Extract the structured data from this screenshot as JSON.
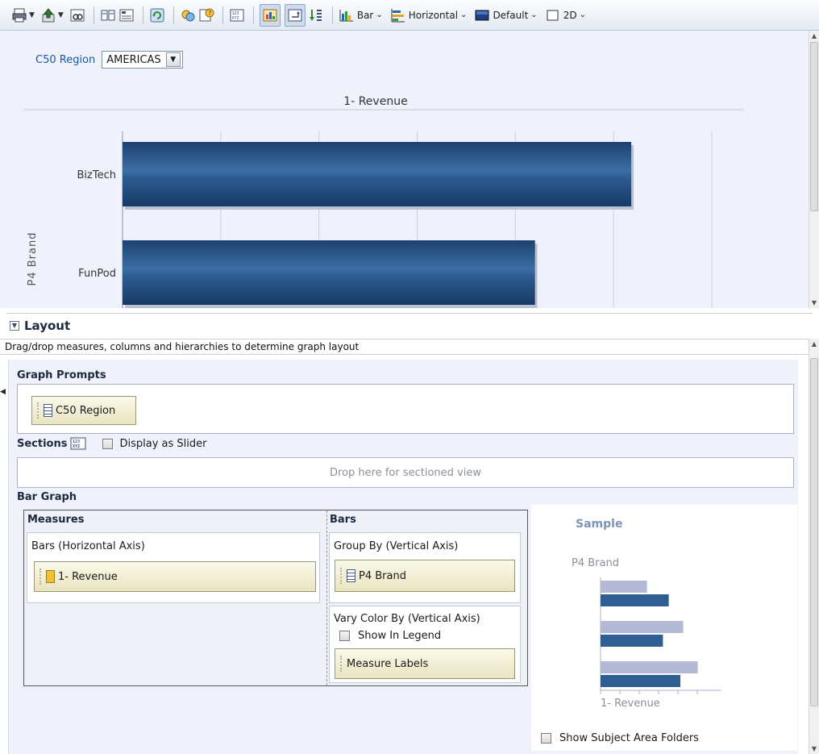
{
  "toolbar": {
    "graph_type_label": "Bar",
    "orientation_label": "Horizontal",
    "style_label": "Default",
    "dimension_label": "2D",
    "icons": [
      "print-icon",
      "export-icon",
      "preview-icon",
      "edit-icon",
      "properties-icon",
      "refresh-icon",
      "add-view-icon",
      "help-icon",
      "section-slider-icon",
      "show-chart-icon",
      "show-pivot-icon",
      "sort-icon",
      "bar-chart-icon",
      "horizontal-bar-icon",
      "style-icon",
      "2d-icon"
    ]
  },
  "prompt": {
    "label": "C50 Region",
    "value": "AMERICAS"
  },
  "chart_data": {
    "type": "bar",
    "orientation": "horizontal",
    "title": "1- Revenue",
    "ylabel": "P4 Brand",
    "categories": [
      "BizTech",
      "FunPod"
    ],
    "values": [
      5.18,
      4.2
    ],
    "xlim": [
      0,
      6
    ],
    "grid": true,
    "bar_color": "#1f4a7c"
  },
  "layout": {
    "title": "Layout",
    "hint": "Drag/drop measures, columns and hierarchies to determine graph layout",
    "graph_prompts_title": "Graph Prompts",
    "graph_prompt_chip": "C50 Region",
    "sections_title": "Sections",
    "display_as_slider": "Display as Slider",
    "sections_drop_hint": "Drop here for sectioned view",
    "bar_graph_title": "Bar Graph",
    "measures_title": "Measures",
    "bars_horizontal_axis": "Bars (Horizontal Axis)",
    "measure_chip": "1- Revenue",
    "bars_title": "Bars",
    "group_by": "Group By (Vertical Axis)",
    "group_chip": "P4 Brand",
    "vary_color_by": "Vary Color By (Vertical Axis)",
    "show_in_legend": "Show In Legend",
    "measure_labels_chip": "Measure Labels",
    "show_subject_area_folders": "Show Subject Area Folders"
  },
  "sample": {
    "title": "Sample",
    "ylabel": "P4 Brand",
    "xlabel": "1- Revenue",
    "groups": [
      {
        "light": 0.32,
        "dark": 0.47
      },
      {
        "light": 0.57,
        "dark": 0.43
      },
      {
        "light": 0.67,
        "dark": 0.55
      }
    ],
    "light_color": "#b3b9d6",
    "dark_color": "#2f5e93"
  }
}
